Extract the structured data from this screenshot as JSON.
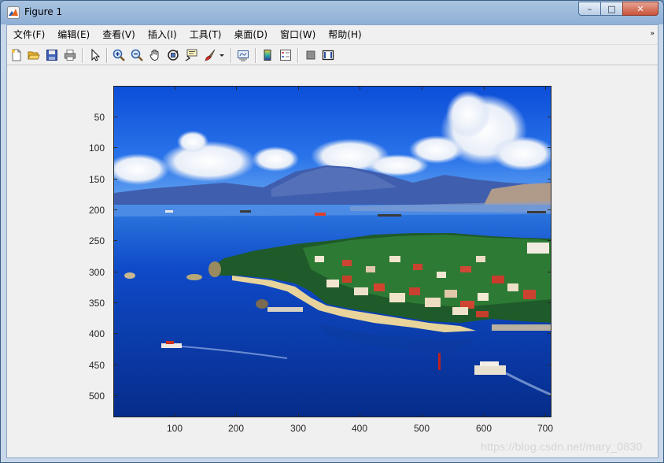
{
  "window": {
    "title": "Figure 1",
    "controls": {
      "minimize": "–",
      "maximize": "□",
      "close": "✕"
    }
  },
  "menubar": {
    "items": [
      {
        "label": "文件(F)"
      },
      {
        "label": "编辑(E)"
      },
      {
        "label": "查看(V)"
      },
      {
        "label": "插入(I)"
      },
      {
        "label": "工具(T)"
      },
      {
        "label": "桌面(D)"
      },
      {
        "label": "窗口(W)"
      },
      {
        "label": "帮助(H)"
      }
    ],
    "overflow_arrow": "»"
  },
  "toolbar": {
    "buttons": [
      "new-figure-icon",
      "open-file-icon",
      "save-icon",
      "print-icon",
      "edit-plot-arrow-icon",
      "zoom-in-icon",
      "zoom-out-icon",
      "pan-hand-icon",
      "rotate-3d-icon",
      "data-cursor-icon",
      "brush-icon",
      "brush-dropdown-icon",
      "link-plot-icon",
      "insert-colorbar-icon",
      "insert-legend-icon",
      "hide-plot-tools-icon",
      "show-plot-tools-icon"
    ]
  },
  "axes": {
    "y_ticks": [
      "50",
      "100",
      "150",
      "200",
      "250",
      "300",
      "350",
      "400",
      "450",
      "500"
    ],
    "x_ticks": [
      "100",
      "200",
      "300",
      "400",
      "500",
      "600",
      "700"
    ],
    "x_range": [
      0,
      710
    ],
    "y_range": [
      0,
      536
    ]
  },
  "image": {
    "subject": "coastal-landscape"
  },
  "watermark": "https://blog.csdn.net/mary_0830",
  "colors": {
    "titlebar": "#a9c3e0",
    "client_bg": "#f0f0f0",
    "sky": "#1d5fe0",
    "sea": "#0d3bb0"
  }
}
